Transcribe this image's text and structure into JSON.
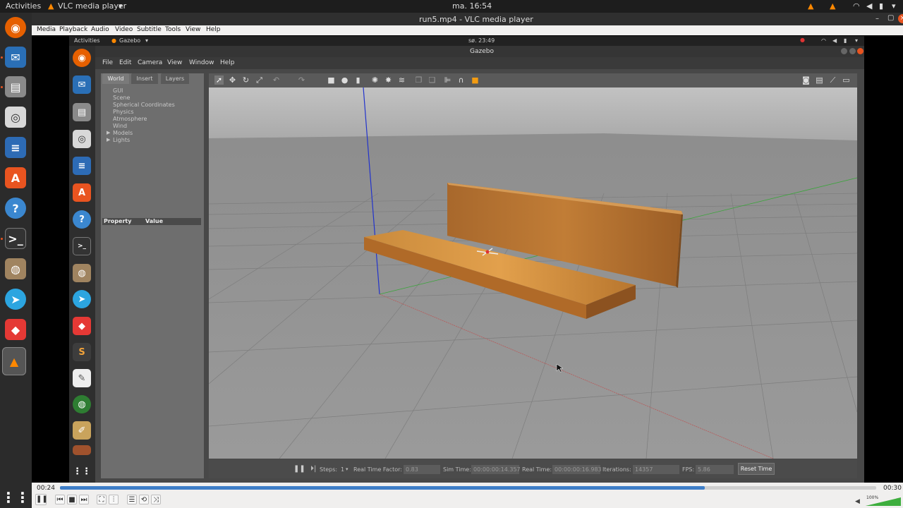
{
  "topbar": {
    "activities": "Activities",
    "app_name": "VLC media player",
    "clock": "ma. 16:54"
  },
  "vlc": {
    "title": "run5.mp4 - VLC media player",
    "menu": [
      "Media",
      "Playback",
      "Audio",
      "Video",
      "Subtitle",
      "Tools",
      "View",
      "Help"
    ],
    "time_current": "00:24",
    "time_total": "00:30",
    "progress_fraction": 0.79,
    "volume": "100%"
  },
  "inner": {
    "activities": "Activities",
    "app_name": "Gazebo",
    "clock": "sø. 23:49"
  },
  "gazebo": {
    "title": "Gazebo",
    "menu": [
      "File",
      "Edit",
      "Camera",
      "View",
      "Window",
      "Help"
    ],
    "tabs": [
      "World",
      "Insert",
      "Layers"
    ],
    "tree": [
      "GUI",
      "Scene",
      "Spherical Coordinates",
      "Physics",
      "Atmosphere",
      "Wind",
      "Models",
      "Lights"
    ],
    "property_header": "Property",
    "value_header": "Value",
    "status": {
      "steps_label": "Steps:",
      "steps_value": "1",
      "rtf_label": "Real Time Factor:",
      "rtf_value": "0.83",
      "sim_label": "Sim Time:",
      "sim_value": "00:00:00:14.357",
      "real_label": "Real Time:",
      "real_value": "00:00:00:16.983",
      "iter_label": "Iterations:",
      "iter_value": "14357",
      "fps_label": "FPS:",
      "fps_value": "5.86",
      "reset_label": "Reset Time"
    }
  },
  "colors": {
    "accent": "#e95420",
    "vlc_orange": "#ff8800",
    "seek_blue": "#3e7ec8"
  }
}
